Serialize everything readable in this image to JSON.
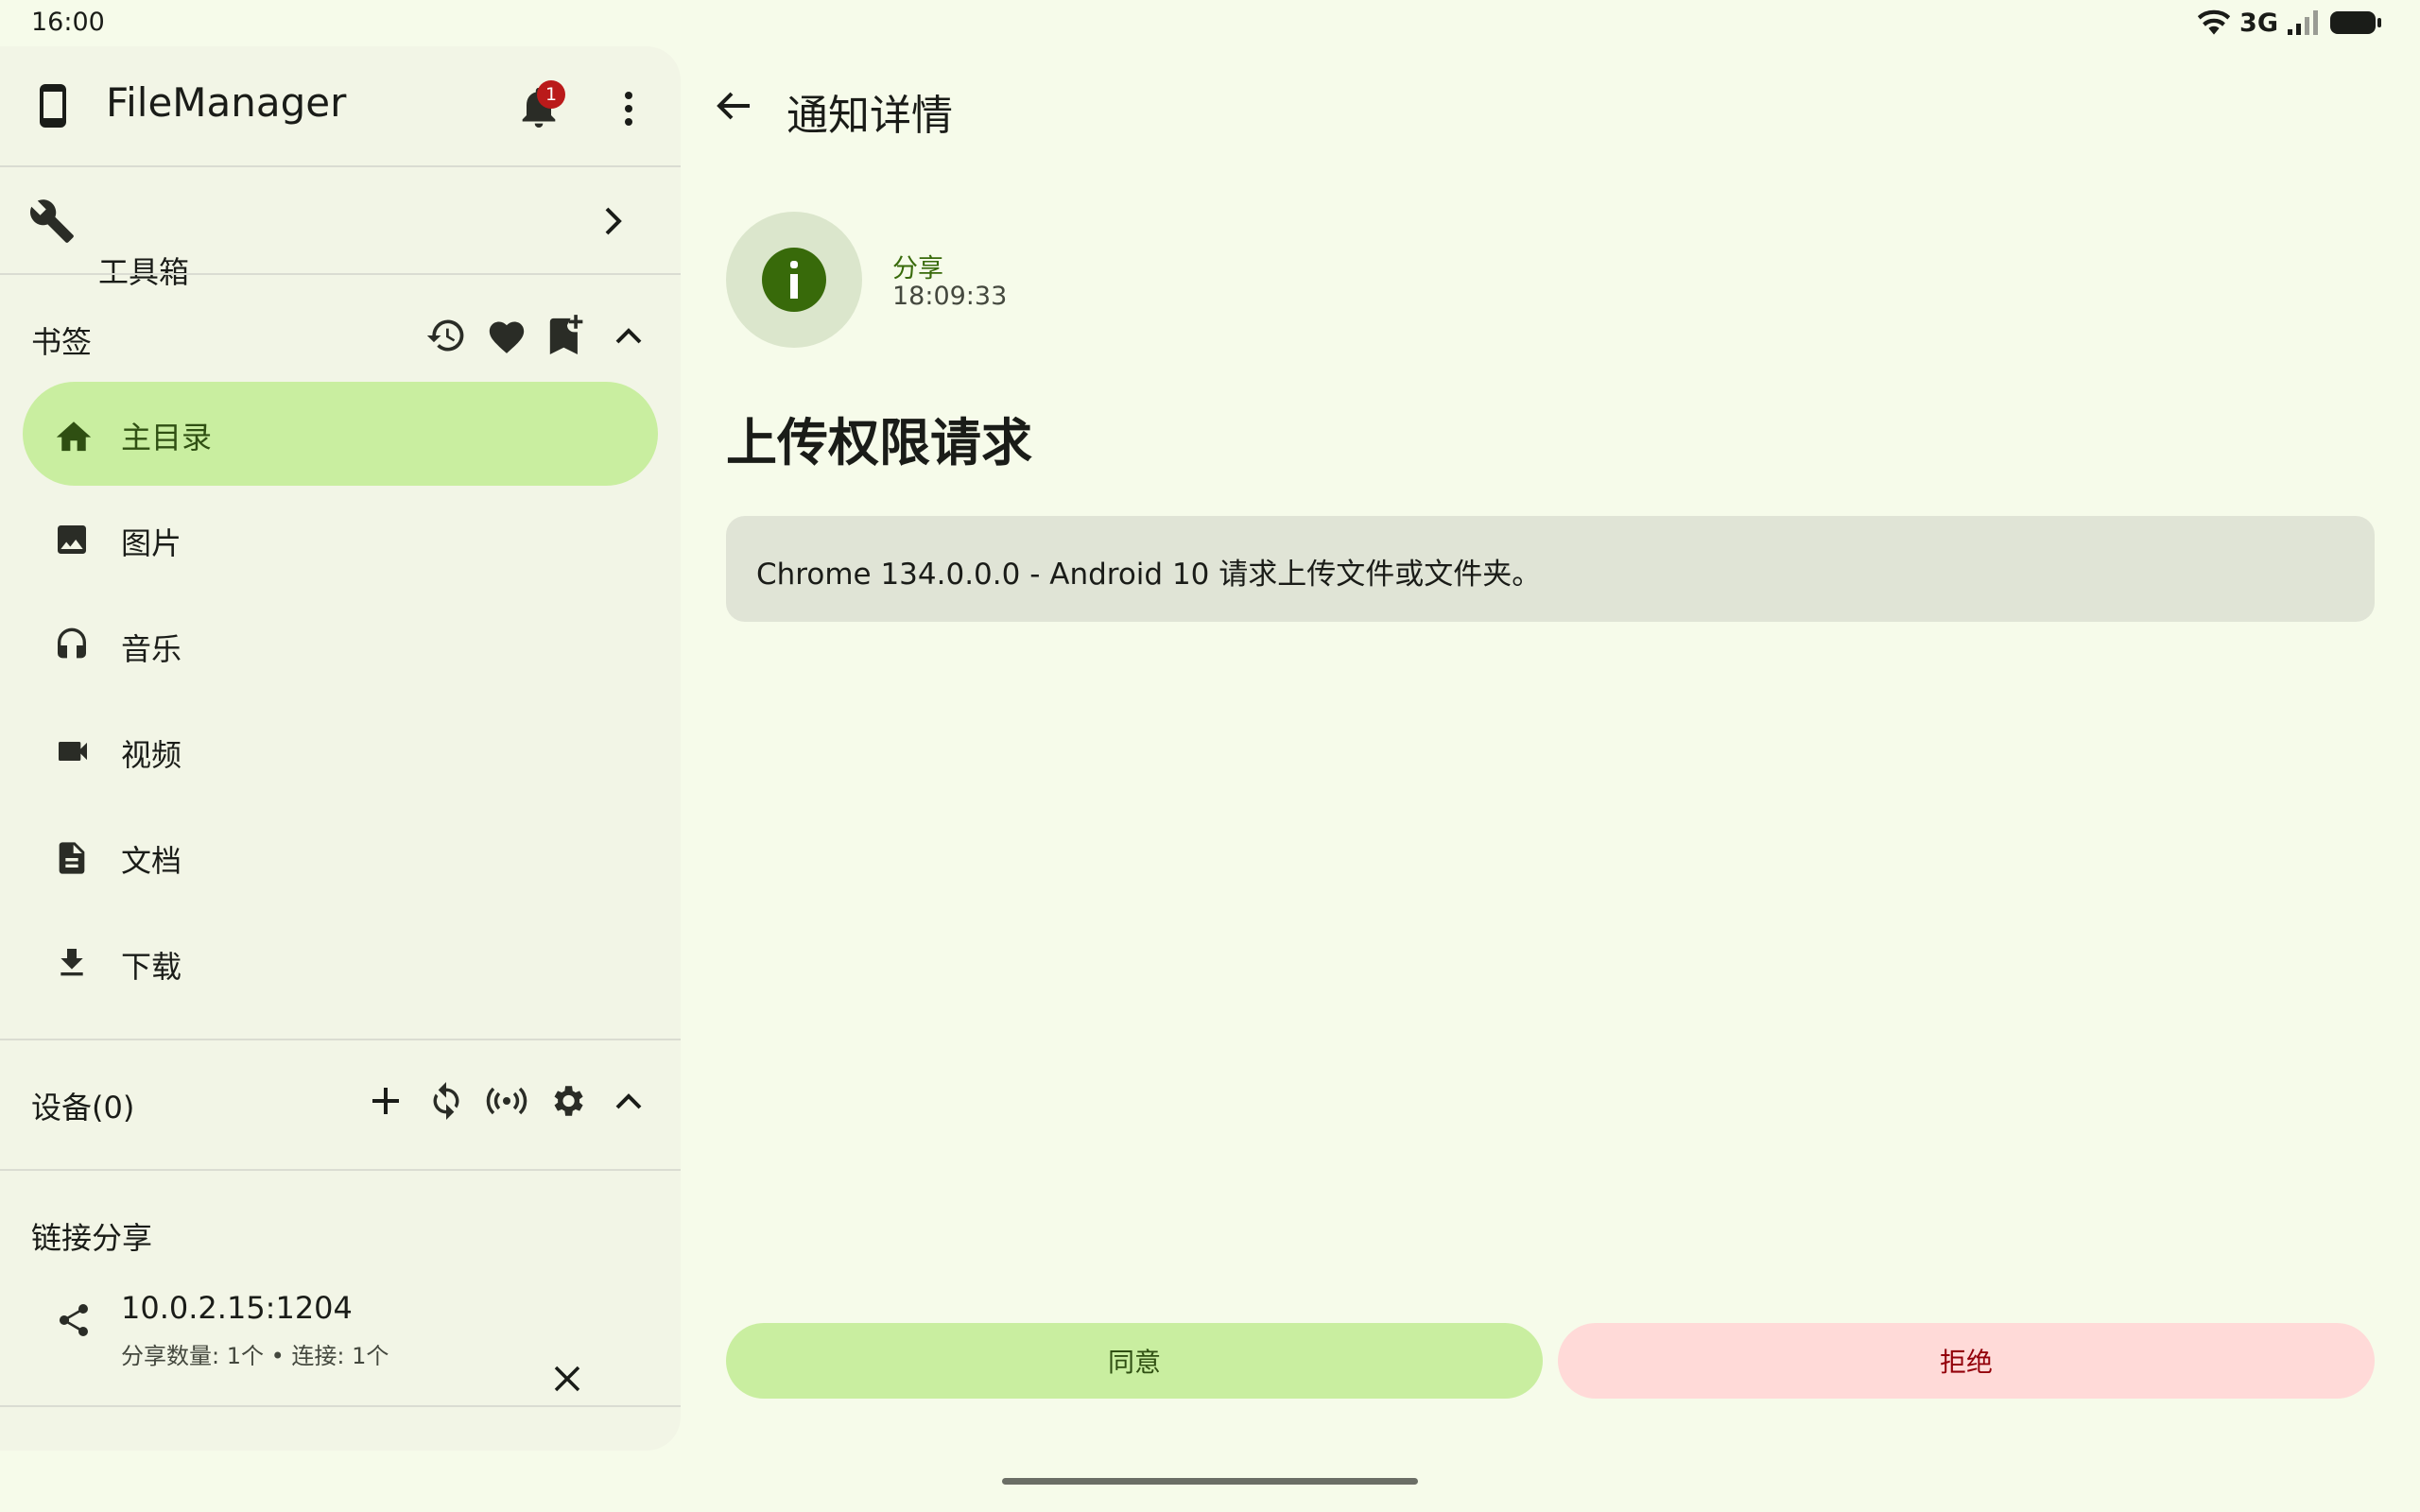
{
  "status_bar": {
    "time": "16:00",
    "network": "3G"
  },
  "drawer": {
    "app_title": "FileManager",
    "notification_count": "1",
    "toolbox_label": "工具箱",
    "bookmarks": {
      "section_label": "书签",
      "items": [
        {
          "label": "主目录",
          "icon": "home-icon",
          "active": true
        },
        {
          "label": "图片",
          "icon": "image-icon",
          "active": false
        },
        {
          "label": "音乐",
          "icon": "headphones-icon",
          "active": false
        },
        {
          "label": "视频",
          "icon": "videocam-icon",
          "active": false
        },
        {
          "label": "文档",
          "icon": "document-icon",
          "active": false
        },
        {
          "label": "下载",
          "icon": "download-icon",
          "active": false
        }
      ]
    },
    "devices": {
      "section_label": "设备(0)"
    },
    "link_share": {
      "section_label": "链接分享",
      "address": "10.0.2.15:1204",
      "detail": "分享数量: 1个 • 连接: 1个"
    }
  },
  "main": {
    "page_title": "通知详情",
    "notification": {
      "source": "分享",
      "time": "18:09:33",
      "title": "上传权限请求",
      "message": "Chrome 134.0.0.0 - Android 10 请求上传文件或文件夹。"
    },
    "actions": {
      "accept_label": "同意",
      "reject_label": "拒绝"
    }
  },
  "colors": {
    "background": "#f6fbea",
    "drawer": "#f2f5e6",
    "accent": "#386a0a",
    "active_pill": "#c9eea0",
    "reject_bg": "#ffdad8",
    "reject_text": "#93000a",
    "badge": "#ba1a1a"
  }
}
